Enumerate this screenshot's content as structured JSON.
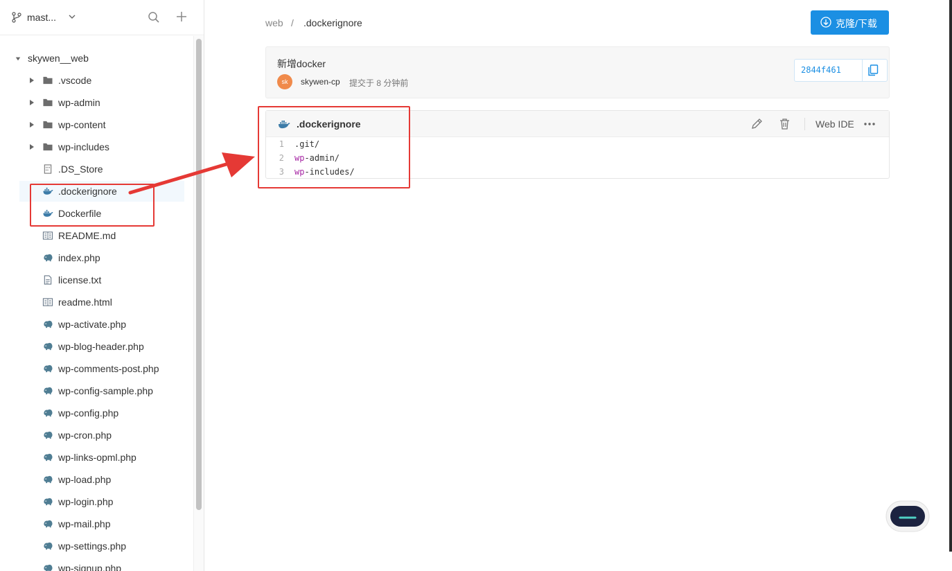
{
  "sidebar": {
    "branch": "mast...",
    "tree": [
      {
        "label": "skywen__web",
        "kind": "folder-open",
        "depth": 0
      },
      {
        "label": ".vscode",
        "kind": "folder",
        "depth": 1
      },
      {
        "label": "wp-admin",
        "kind": "folder",
        "depth": 1
      },
      {
        "label": "wp-content",
        "kind": "folder",
        "depth": 1
      },
      {
        "label": "wp-includes",
        "kind": "folder",
        "depth": 1
      },
      {
        "label": ".DS_Store",
        "kind": "binary",
        "depth": 1
      },
      {
        "label": ".dockerignore",
        "kind": "docker",
        "depth": 1,
        "active": true
      },
      {
        "label": "Dockerfile",
        "kind": "docker",
        "depth": 1
      },
      {
        "label": "README.md",
        "kind": "doc",
        "depth": 1
      },
      {
        "label": "index.php",
        "kind": "php",
        "depth": 1
      },
      {
        "label": "license.txt",
        "kind": "text",
        "depth": 1
      },
      {
        "label": "readme.html",
        "kind": "doc",
        "depth": 1
      },
      {
        "label": "wp-activate.php",
        "kind": "php",
        "depth": 1
      },
      {
        "label": "wp-blog-header.php",
        "kind": "php",
        "depth": 1
      },
      {
        "label": "wp-comments-post.php",
        "kind": "php",
        "depth": 1
      },
      {
        "label": "wp-config-sample.php",
        "kind": "php",
        "depth": 1
      },
      {
        "label": "wp-config.php",
        "kind": "php",
        "depth": 1
      },
      {
        "label": "wp-cron.php",
        "kind": "php",
        "depth": 1
      },
      {
        "label": "wp-links-opml.php",
        "kind": "php",
        "depth": 1
      },
      {
        "label": "wp-load.php",
        "kind": "php",
        "depth": 1
      },
      {
        "label": "wp-login.php",
        "kind": "php",
        "depth": 1
      },
      {
        "label": "wp-mail.php",
        "kind": "php",
        "depth": 1
      },
      {
        "label": "wp-settings.php",
        "kind": "php",
        "depth": 1
      },
      {
        "label": "wp-signup.php",
        "kind": "php",
        "depth": 1
      }
    ]
  },
  "breadcrumb": {
    "root": "web",
    "sep": "/",
    "file": ".dockerignore"
  },
  "clone_button": "克隆/下载",
  "commit": {
    "title": "新增docker",
    "avatar": "sk",
    "author": "skywen-cp",
    "time": "提交于 8 分钟前",
    "sha": "2844f461"
  },
  "file": {
    "name": ".dockerignore",
    "web_ide": "Web IDE",
    "lines": [
      {
        "n": "1",
        "pre": "",
        "kw": "",
        "post": ".git/"
      },
      {
        "n": "2",
        "pre": "",
        "kw": "wp",
        "post": "-admin/"
      },
      {
        "n": "3",
        "pre": "",
        "kw": "wp",
        "post": "-includes/"
      }
    ]
  },
  "colors": {
    "accent": "#1b8fe3",
    "annotation": "#e53935",
    "avatar": "#f08a4b"
  }
}
